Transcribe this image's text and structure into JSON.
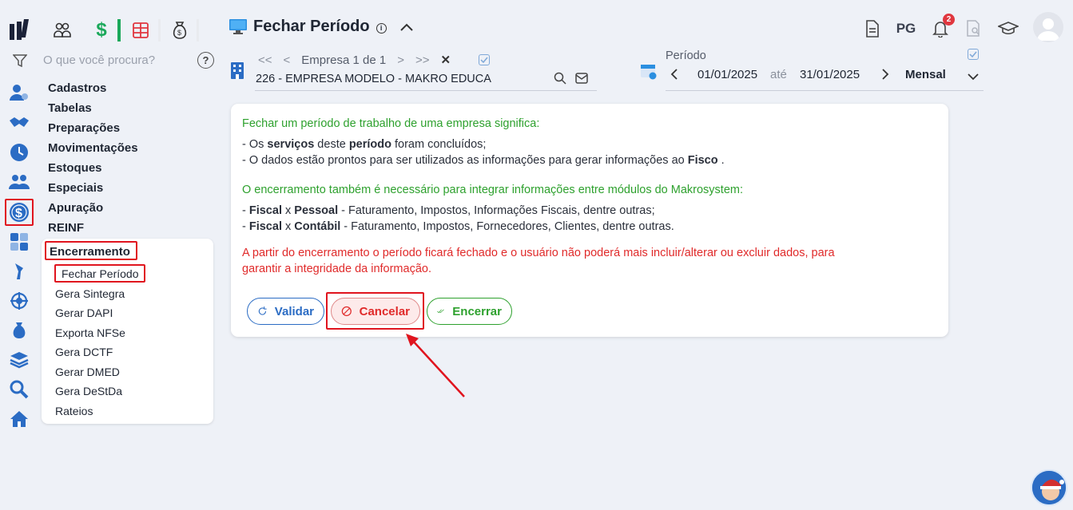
{
  "topbar": {
    "icons": [
      "logo-icon",
      "users-icon",
      "dollar-icon",
      "table-icon",
      "money-bag-icon"
    ],
    "page_title": "Fechar Período",
    "info_label": "i",
    "right_pg": "PG",
    "notification_count": "2"
  },
  "sidebar": {
    "search_placeholder": "O que você procura?",
    "help_label": "?",
    "menu": [
      "Cadastros",
      "Tabelas",
      "Preparações",
      "Movimentações",
      "Estoques",
      "Especiais",
      "Apuração",
      "REINF"
    ],
    "submenu_title": "Encerramento",
    "submenu_items": [
      "Fechar Período",
      "Gera Sintegra",
      "Gerar DAPI",
      "Exporta NFSe",
      "Gera DCTF",
      "Gerar DMED",
      "Gera DeStDa",
      "Rateios"
    ]
  },
  "company": {
    "nav_first": "<<",
    "nav_prev": "<",
    "counter": "Empresa 1 de 1",
    "nav_next": ">",
    "nav_last": ">>",
    "clear": "✕",
    "name": "226 - EMPRESA MODELO - MAKRO EDUCA"
  },
  "period": {
    "label": "Período",
    "start": "01/01/2025",
    "until": "até",
    "end": "31/01/2025",
    "type": "Mensal"
  },
  "card": {
    "heading1": "Fechar um período de trabalho de uma empresa significa:",
    "line1_a": "- Os ",
    "line1_b": "serviços",
    "line1_c": " deste ",
    "line1_d": "período",
    "line1_e": " foram concluídos;",
    "line2_a": "- O dados estão prontos para ser utilizados as informações para gerar informações ao ",
    "line2_b": "Fisco",
    "line2_c": " .",
    "heading2": "O encerramento também é necessário para integrar informações entre módulos do Makrosystem:",
    "line3_a": "- ",
    "line3_b": "Fiscal",
    "line3_c": " x ",
    "line3_d": "Pessoal",
    "line3_e": " - Faturamento, Impostos, Informações Fiscais, dentre outras;",
    "line4_a": "- ",
    "line4_b": "Fiscal",
    "line4_c": " x ",
    "line4_d": "Contábil",
    "line4_e": " - Faturamento, Impostos, Fornecedores, Clientes, dentre outras.",
    "warning1": "A partir do encerramento o período ficará fechado e o usuário não poderá mais incluir/alterar ou excluir dados, para",
    "warning2": "garantir a integridade da informação.",
    "btn_validar": "Validar",
    "btn_cancelar": "Cancelar",
    "btn_encerrar": "Encerrar"
  },
  "colors": {
    "green": "#2ea12e",
    "red": "#e02a2a",
    "blue": "#2b6cc4",
    "highlight": "#e0141e"
  }
}
